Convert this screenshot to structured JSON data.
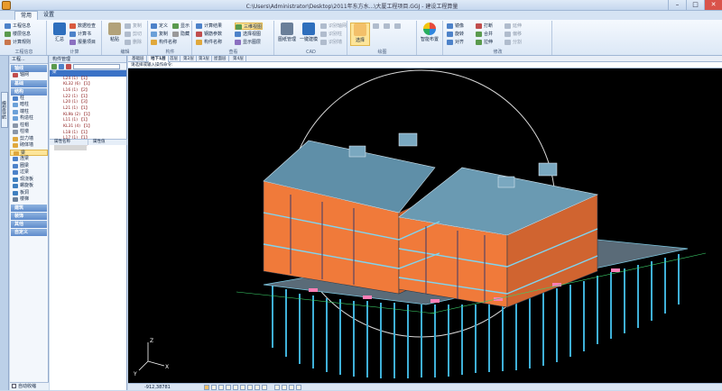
{
  "window": {
    "title": "C:\\Users\\Administrator\\Desktop\\2011年东方水...\\大厦工程项目.GGJ - 建设工程算量",
    "min": "–",
    "max": "□",
    "close": "✕"
  },
  "tabs": [
    "常用",
    "设置"
  ],
  "ribbon": {
    "project_group": {
      "label": "工程信息",
      "items": [
        "工程信息",
        "楼层信息",
        "计算规则"
      ]
    },
    "calc_group": {
      "label": "计算",
      "sum": "汇总",
      "items": [
        "数据检查",
        "计算书",
        "报量项目"
      ]
    },
    "edit_group": {
      "label": "编辑",
      "paste": "粘贴",
      "items": [
        "复制",
        "剪切",
        "删除"
      ]
    },
    "component_group": {
      "label": "构件",
      "items": [
        "定义",
        "复制",
        "显示",
        "隐藏",
        "构件名称",
        "标注"
      ]
    },
    "view_group": {
      "label": "查看",
      "items": [
        "计算结果",
        "钢筋参数",
        "构件名称",
        "三维视图",
        "选择视图",
        "显示图层"
      ]
    },
    "floor_btn": "图纸管理",
    "cad_group": {
      "label": "CAD",
      "main": "一键建模",
      "items": [
        "识别轴网",
        "识别柱",
        "识别墙",
        "识别梁"
      ]
    },
    "draw_group": {
      "label": "绘图",
      "select": "选择"
    },
    "smart_btn": "智能布置",
    "modify_group": {
      "label": "修改",
      "items": [
        "镜像",
        "打断",
        "旋转",
        "合并",
        "延伸",
        "偏移",
        "对齐",
        "拉伸",
        "分割"
      ]
    }
  },
  "sidebar": {
    "tab_label": "模型导航"
  },
  "nav": {
    "header": "工程...",
    "categories": [
      {
        "label": "轴线",
        "items": [
          "轴网"
        ]
      },
      {
        "label": "基础",
        "items": []
      },
      {
        "label": "结构",
        "items": [
          "柱",
          "暗柱",
          "端柱",
          "构造柱",
          "柱帽",
          "柱墩",
          "剪力墙",
          "砌体墙",
          "梁",
          "连梁",
          "圈梁",
          "过梁",
          "现浇板",
          "螺旋板",
          "板洞",
          "楼梯"
        ]
      },
      {
        "label": "建筑",
        "items": []
      },
      {
        "label": "装饰",
        "items": []
      },
      {
        "label": "其他",
        "items": []
      },
      {
        "label": "自定义",
        "items": []
      }
    ],
    "selected": "梁",
    "footer": "自动收缩"
  },
  "tree": {
    "title": "构件管理",
    "search_placeholder": "",
    "root": "梁",
    "rows": [
      "L24 (1) 【1】",
      "KL32 (6) 【1】",
      "L16 (1) 【2】",
      "L22 (1) 【1】",
      "L20 (1) 【3】",
      "L21 (1) 【1】",
      "KL9b (2) 【1】",
      "L11 (1) 【1】",
      "KL31 (4) 【1】",
      "L18 (1) 【1】",
      "L17 (1) 【1】",
      "L19 (1) 【1】"
    ],
    "prop_headers": [
      "属性名称",
      "属性值"
    ]
  },
  "floors": [
    "基础层",
    "地下1层",
    "首层",
    "第2层",
    "第3层",
    "屋面层",
    "第4层"
  ],
  "active_floor": "地下1层",
  "cmd_prompt": "请选择或输入操作命令:",
  "axis": {
    "z": "Z",
    "x": "X",
    "y": "Y"
  },
  "status": {
    "coord": "-912,38781"
  }
}
